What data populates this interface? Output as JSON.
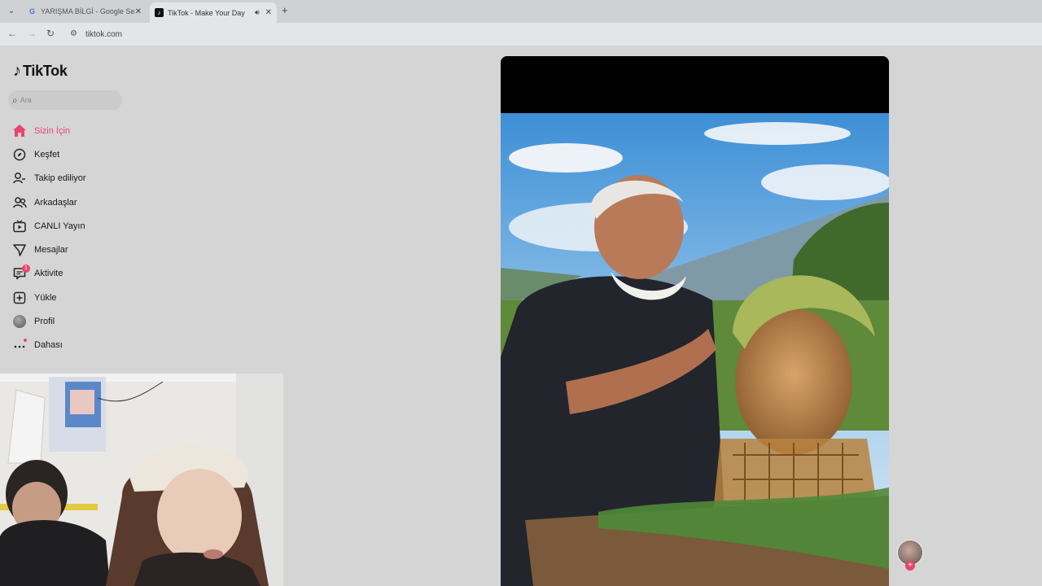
{
  "browser": {
    "tabs": [
      {
        "title": "YARIŞMA BİLGİ - Google Search",
        "favicon": "google-icon"
      },
      {
        "title": "TikTok - Make Your Day",
        "favicon": "tiktok-icon",
        "audio": true
      }
    ],
    "url": "tiktok.com"
  },
  "app": {
    "logo_text": "TikTok"
  },
  "search": {
    "placeholder": "Ara"
  },
  "menu": [
    {
      "label": "Sizin İçin",
      "icon": "home-icon",
      "active": true
    },
    {
      "label": "Keşfet",
      "icon": "compass-icon"
    },
    {
      "label": "Takip ediliyor",
      "icon": "following-icon"
    },
    {
      "label": "Arkadaşlar",
      "icon": "friends-icon"
    },
    {
      "label": "CANLI Yayın",
      "icon": "live-icon"
    },
    {
      "label": "Mesajlar",
      "icon": "messages-icon"
    },
    {
      "label": "Aktivite",
      "icon": "activity-icon",
      "badge": "1"
    },
    {
      "label": "Yükle",
      "icon": "upload-icon"
    },
    {
      "label": "Profil",
      "icon": "profile-avatar"
    },
    {
      "label": "Dahası",
      "icon": "more-icon",
      "dot": true
    }
  ],
  "colors": {
    "accent": "#e9446e"
  }
}
